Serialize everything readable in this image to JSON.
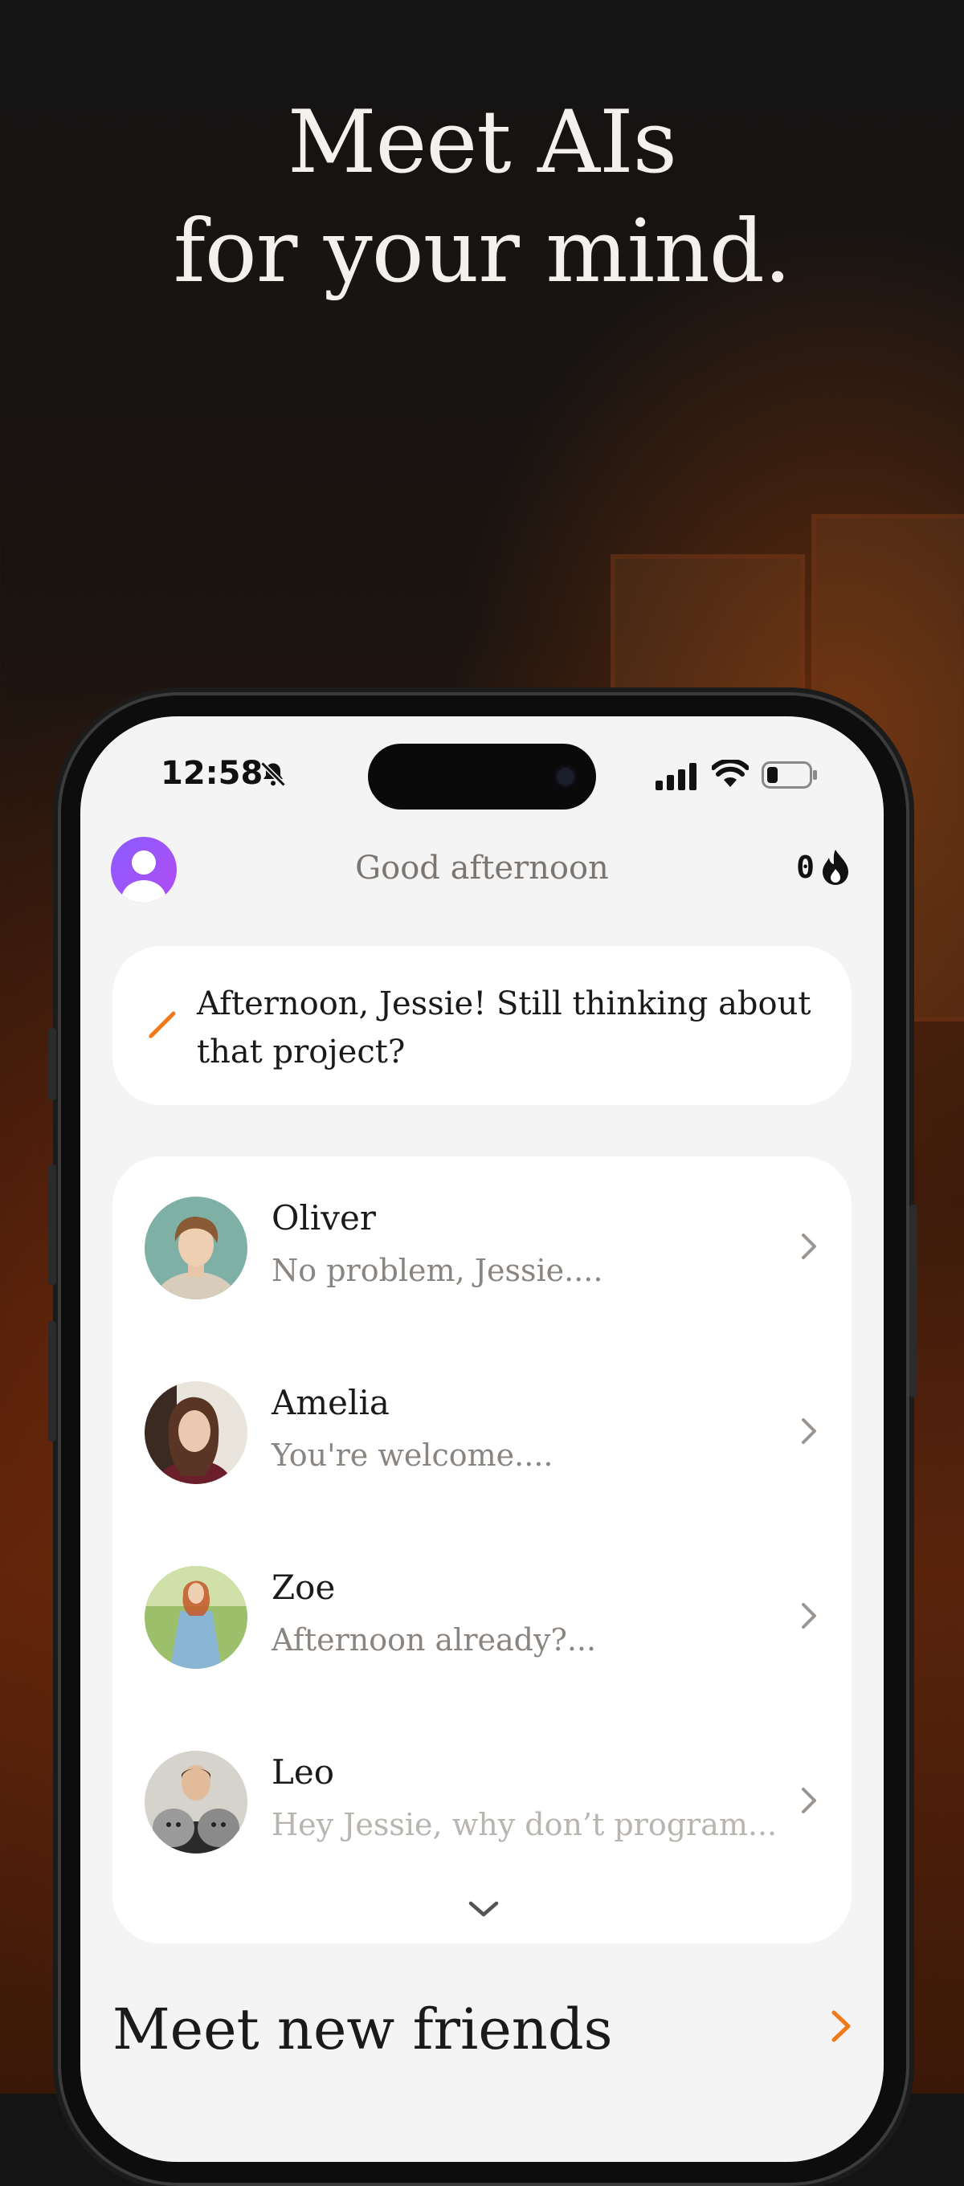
{
  "hero": {
    "line1": "Meet AIs",
    "line2": "for your mind."
  },
  "status_bar": {
    "time": "12:58"
  },
  "header": {
    "greeting": "Good afternoon",
    "streak_count": "0"
  },
  "prompt": {
    "text": "Afternoon, Jessie! Still thinking about that project?"
  },
  "chats": [
    {
      "name": "Oliver",
      "message": "No problem, Jessie....",
      "avatar": "portrait-oliver"
    },
    {
      "name": "Amelia",
      "message": "You're welcome....",
      "avatar": "portrait-amelia"
    },
    {
      "name": "Zoe",
      "message": "Afternoon already?...",
      "avatar": "portrait-zoe"
    },
    {
      "name": "Leo",
      "message": "Hey Jessie, why don’t program...",
      "avatar": "portrait-leo"
    }
  ],
  "section": {
    "title": "Meet new friends"
  },
  "colors": {
    "accent": "#f07a1a",
    "avatar_gradient": "#8a5cff"
  }
}
